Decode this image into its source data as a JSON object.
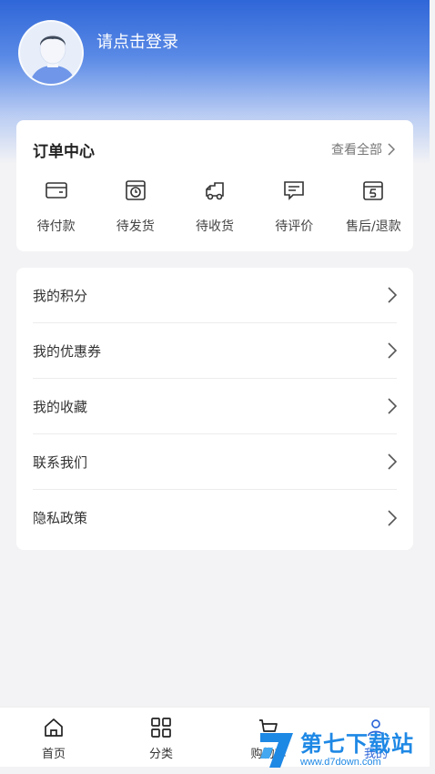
{
  "header": {
    "login_text": "请点击登录"
  },
  "order_center": {
    "title": "订单中心",
    "view_all": "查看全部",
    "items": [
      {
        "label": "待付款",
        "icon": "wallet-icon"
      },
      {
        "label": "待发货",
        "icon": "box-clock-icon"
      },
      {
        "label": "待收货",
        "icon": "truck-icon"
      },
      {
        "label": "待评价",
        "icon": "comment-icon"
      },
      {
        "label": "售后/退款",
        "icon": "refund-icon"
      }
    ]
  },
  "menu": {
    "items": [
      {
        "label": "我的积分"
      },
      {
        "label": "我的优惠券"
      },
      {
        "label": "我的收藏"
      },
      {
        "label": "联系我们"
      },
      {
        "label": "隐私政策"
      }
    ]
  },
  "tabbar": {
    "tabs": [
      {
        "label": "首页",
        "icon": "home-icon"
      },
      {
        "label": "分类",
        "icon": "grid-icon"
      },
      {
        "label": "购物车",
        "icon": "cart-icon"
      },
      {
        "label": "我的",
        "icon": "user-icon"
      }
    ]
  },
  "watermark": {
    "name": "第七下载站",
    "url": "www.d7down.com"
  },
  "colors": {
    "brand_blue": "#2f66d8",
    "background": "#f3f3f5",
    "watermark_blue": "#1e88e5"
  }
}
